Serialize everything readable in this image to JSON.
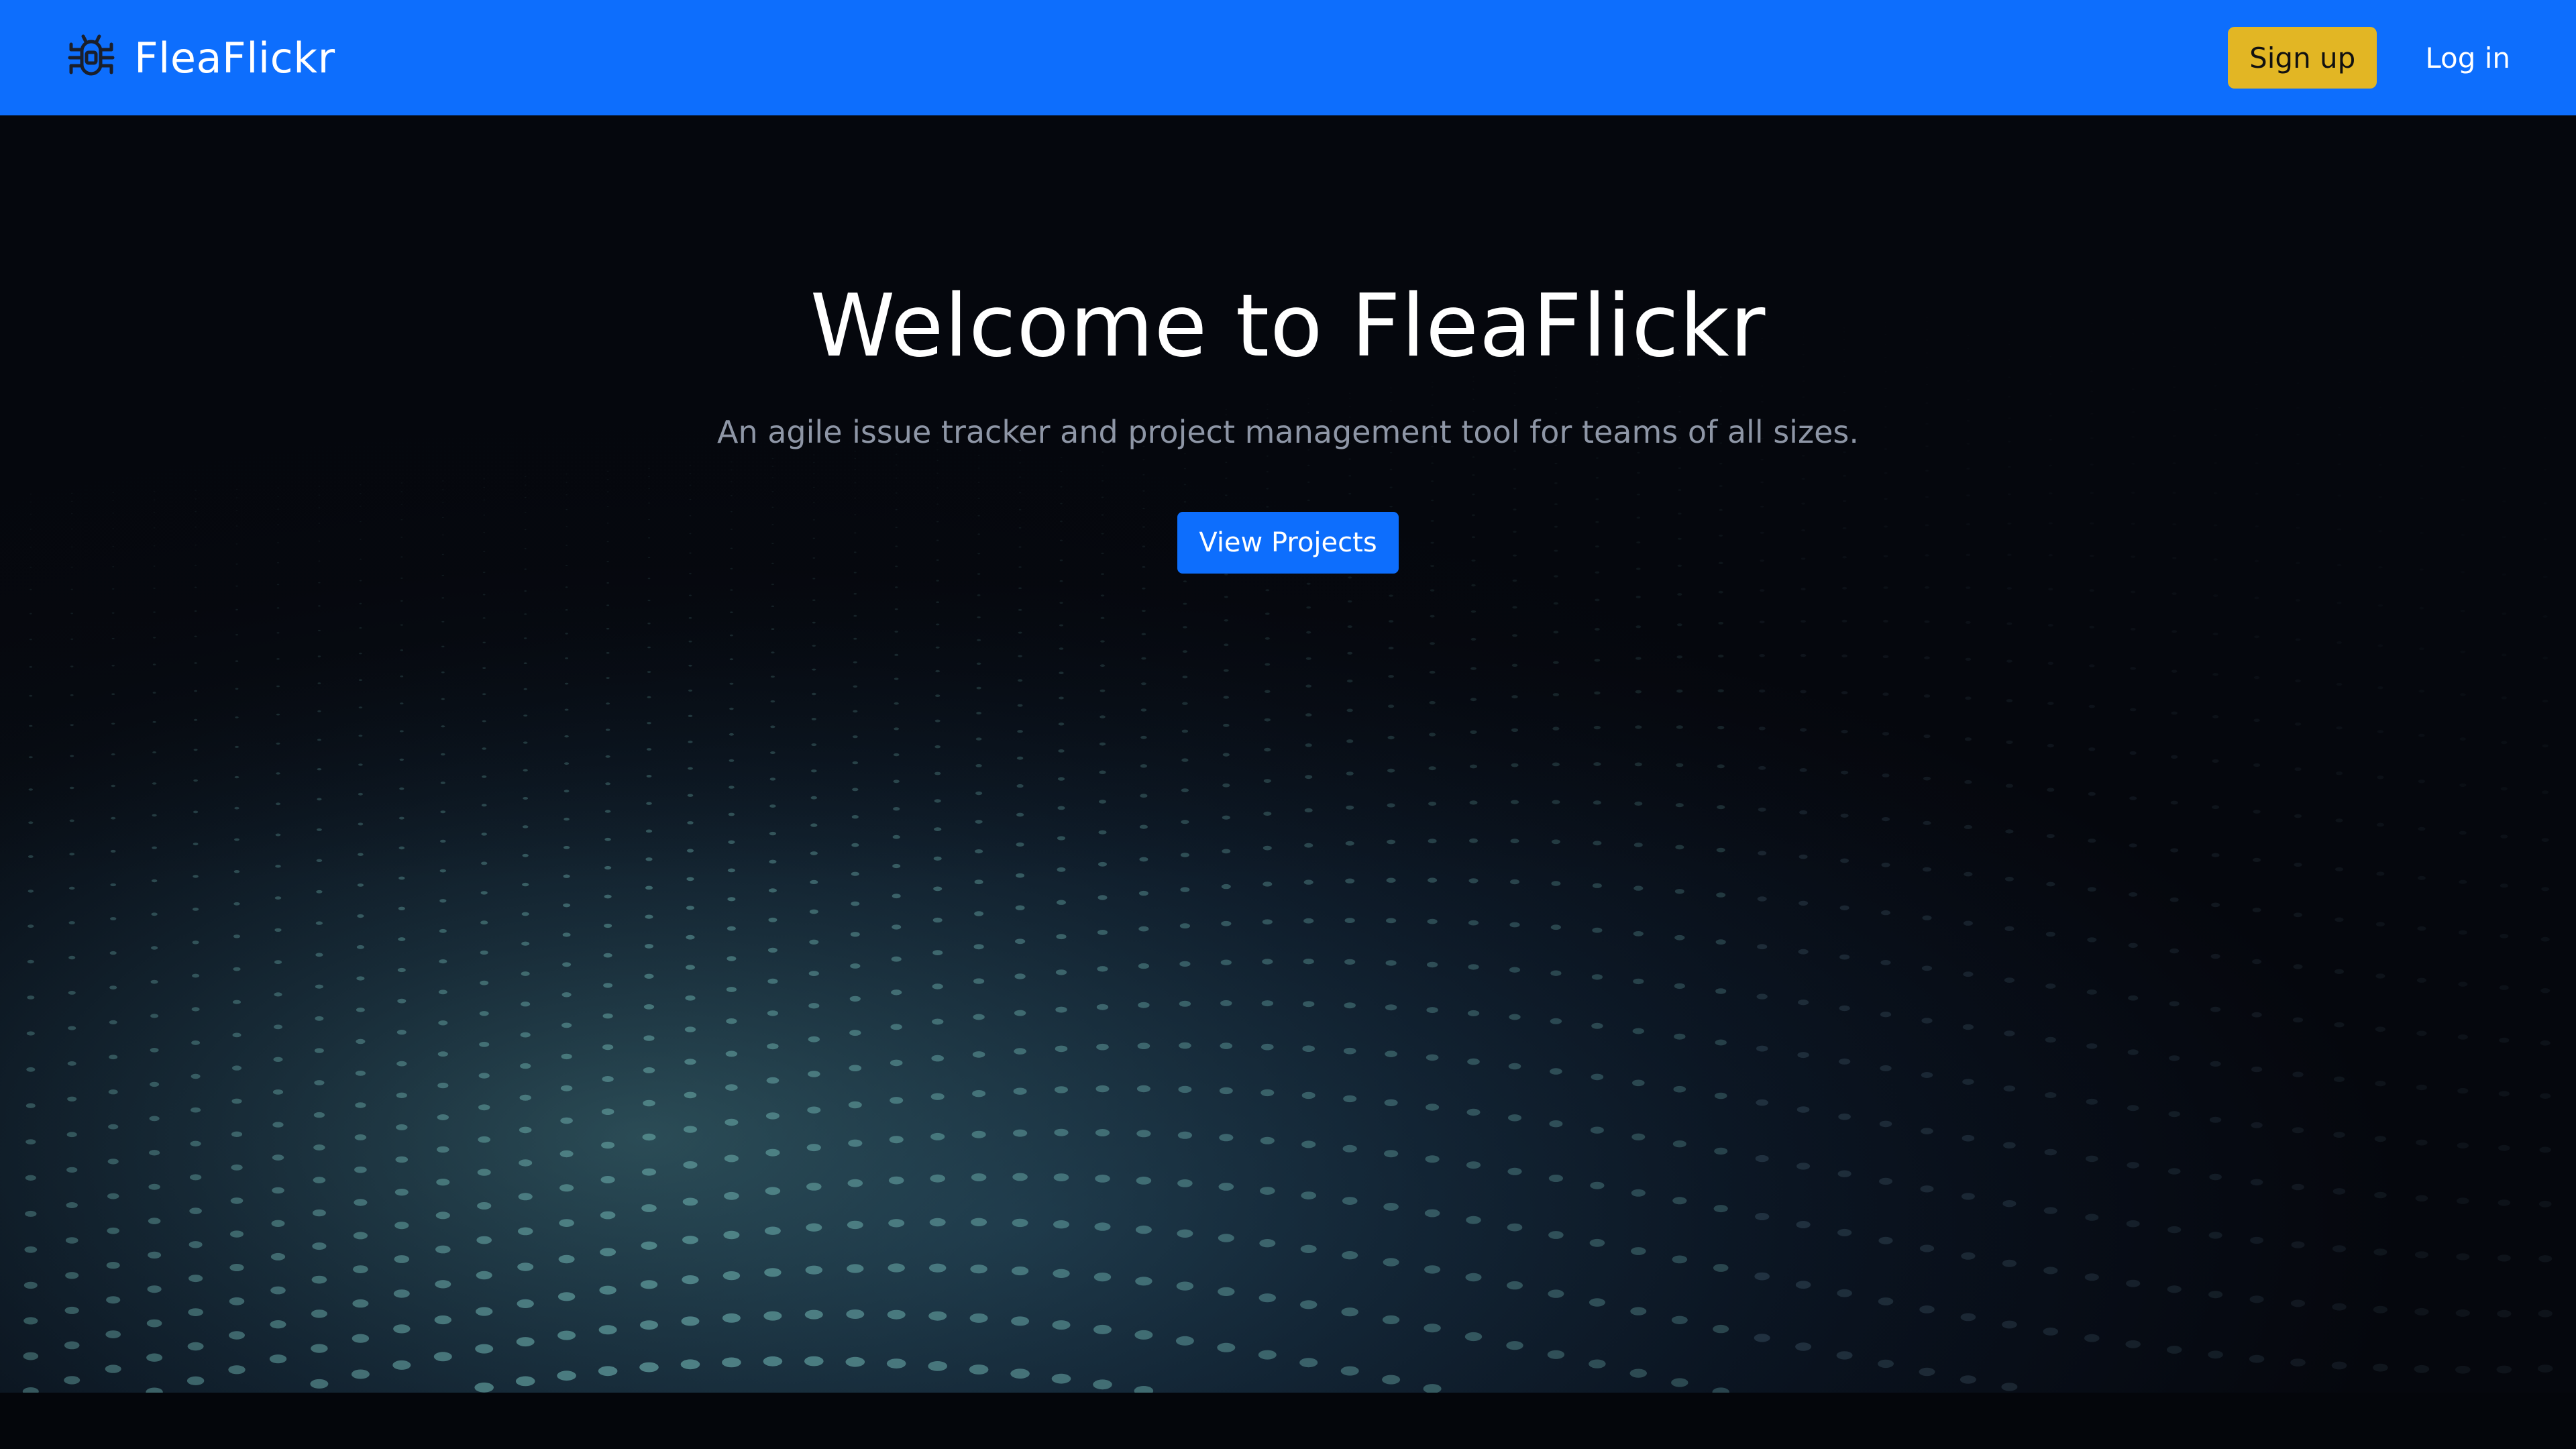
{
  "navbar": {
    "brand_name": "FleaFlickr",
    "brand_icon": "bug-icon",
    "signup_label": "Sign up",
    "login_label": "Log in",
    "colors": {
      "bar": "#0d6efd",
      "signup": "#e2b624"
    }
  },
  "hero": {
    "title": "Welcome to FleaFlickr",
    "subtitle": "An agile issue tracker and project management tool for teams of all sizes.",
    "cta_label": "View Projects",
    "background": "wave-dot-pattern-image"
  }
}
